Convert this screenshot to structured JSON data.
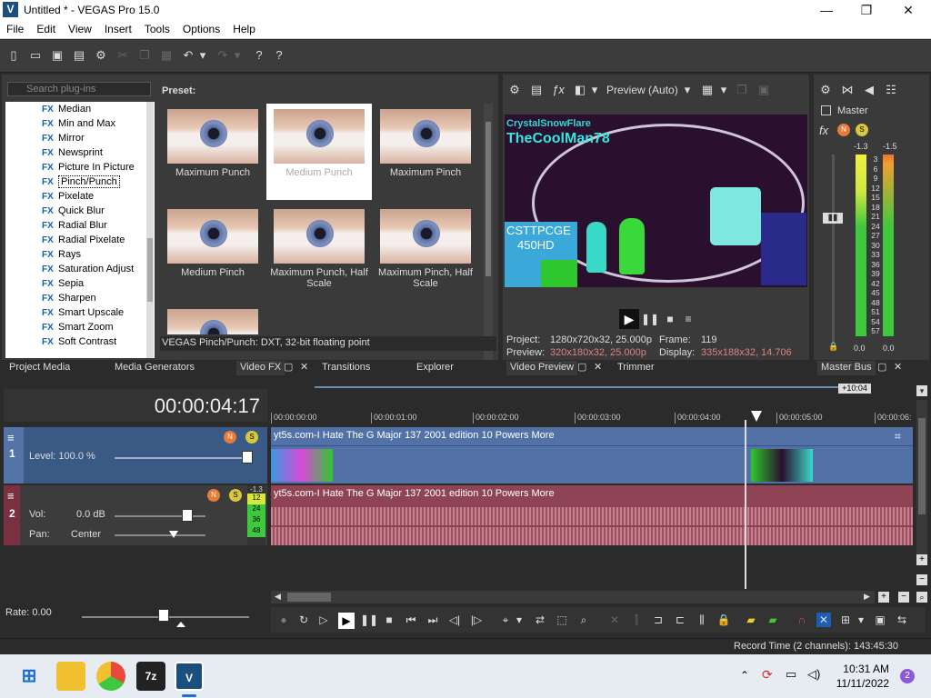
{
  "window": {
    "title": "Untitled * - VEGAS Pro 15.0",
    "logo": "V",
    "minimize": "—",
    "maximize": "❐",
    "close": "✕"
  },
  "menu": [
    "File",
    "Edit",
    "View",
    "Insert",
    "Tools",
    "Options",
    "Help"
  ],
  "plugins": {
    "search_placeholder": "Search plug-ins",
    "fx_tag": "FX",
    "items": [
      "Median",
      "Min and Max",
      "Mirror",
      "Newsprint",
      "Picture In Picture",
      "Pinch/Punch",
      "Pixelate",
      "Quick Blur",
      "Radial Blur",
      "Radial Pixelate",
      "Rays",
      "Saturation Adjust",
      "Sepia",
      "Sharpen",
      "Smart Upscale",
      "Smart Zoom",
      "Soft Contrast"
    ],
    "selected": "Pinch/Punch",
    "preset_label": "Preset:",
    "presets": [
      "Maximum Punch",
      "Medium Punch",
      "Maximum Pinch",
      "Medium Pinch",
      "Maximum Punch, Half Scale",
      "Maximum Pinch, Half Scale"
    ],
    "selected_preset": "Medium Punch",
    "status": "VEGAS Pinch/Punch: DXT, 32-bit floating point"
  },
  "left_tabs": {
    "project_media": "Project Media",
    "media_generators": "Media Generators",
    "video_fx": "Video FX",
    "transitions": "Transitions",
    "explorer": "Explorer"
  },
  "preview": {
    "mode": "Preview (Auto)",
    "frame_text_1": "CrystalSnowFlare",
    "frame_text_2": "TheCoolMan78",
    "frame_text_3": "CSTTPCGE",
    "frame_text_4": "450HD",
    "project_label": "Project:",
    "project_value": "1280x720x32, 25.000p",
    "preview_label": "Preview:",
    "preview_value": "320x180x32, 25.000p",
    "frame_label": "Frame:",
    "frame_value": "119",
    "display_label": "Display:",
    "display_value": "335x188x32, 14.706",
    "tab_video_preview": "Video Preview",
    "tab_trimmer": "Trimmer"
  },
  "master": {
    "label": "Master",
    "left_peak": "-1.3",
    "right_peak": "-1.5",
    "scale": [
      "3",
      "6",
      "9",
      "12",
      "15",
      "18",
      "21",
      "24",
      "27",
      "30",
      "33",
      "36",
      "39",
      "42",
      "45",
      "48",
      "51",
      "54",
      "57"
    ],
    "left_bottom": "0.0",
    "right_bottom": "0.0",
    "tab": "Master Bus",
    "fx": "fx"
  },
  "timeline": {
    "timecode": "00:00:04:17",
    "loop_marker": "+10:04",
    "ruler": [
      "00:00:00:00",
      "00:00:01:00",
      "00:00:02:00",
      "00:00:03:00",
      "00:00:04:00",
      "00:00:05:00",
      "00:00:06:"
    ],
    "track1": {
      "number": "1",
      "level_label": "Level: 100.0 %",
      "clip_name": "yt5s.com-I Hate The G Major 137 2001 edition 10 Powers More"
    },
    "track2": {
      "number": "2",
      "vol_label": "Vol:",
      "vol_value": "0.0 dB",
      "pan_label": "Pan:",
      "pan_value": "Center",
      "meter_values": [
        "-1.3",
        "12",
        "24",
        "36",
        "48"
      ],
      "clip_name": "yt5s.com-I Hate The G Major 137 2001 edition 10 Powers More"
    },
    "rate": "Rate: 0.00"
  },
  "status": {
    "record_time": "Record Time (2 channels): 143:45:30"
  },
  "taskbar": {
    "time": "10:31 AM",
    "date": "11/11/2022",
    "notifications": "2",
    "app_7z": "7z",
    "app_vegas": "V"
  },
  "colors": {
    "accent": "#1a5fb4",
    "video_track": "#5271a6",
    "audio_track": "#8e4454"
  }
}
